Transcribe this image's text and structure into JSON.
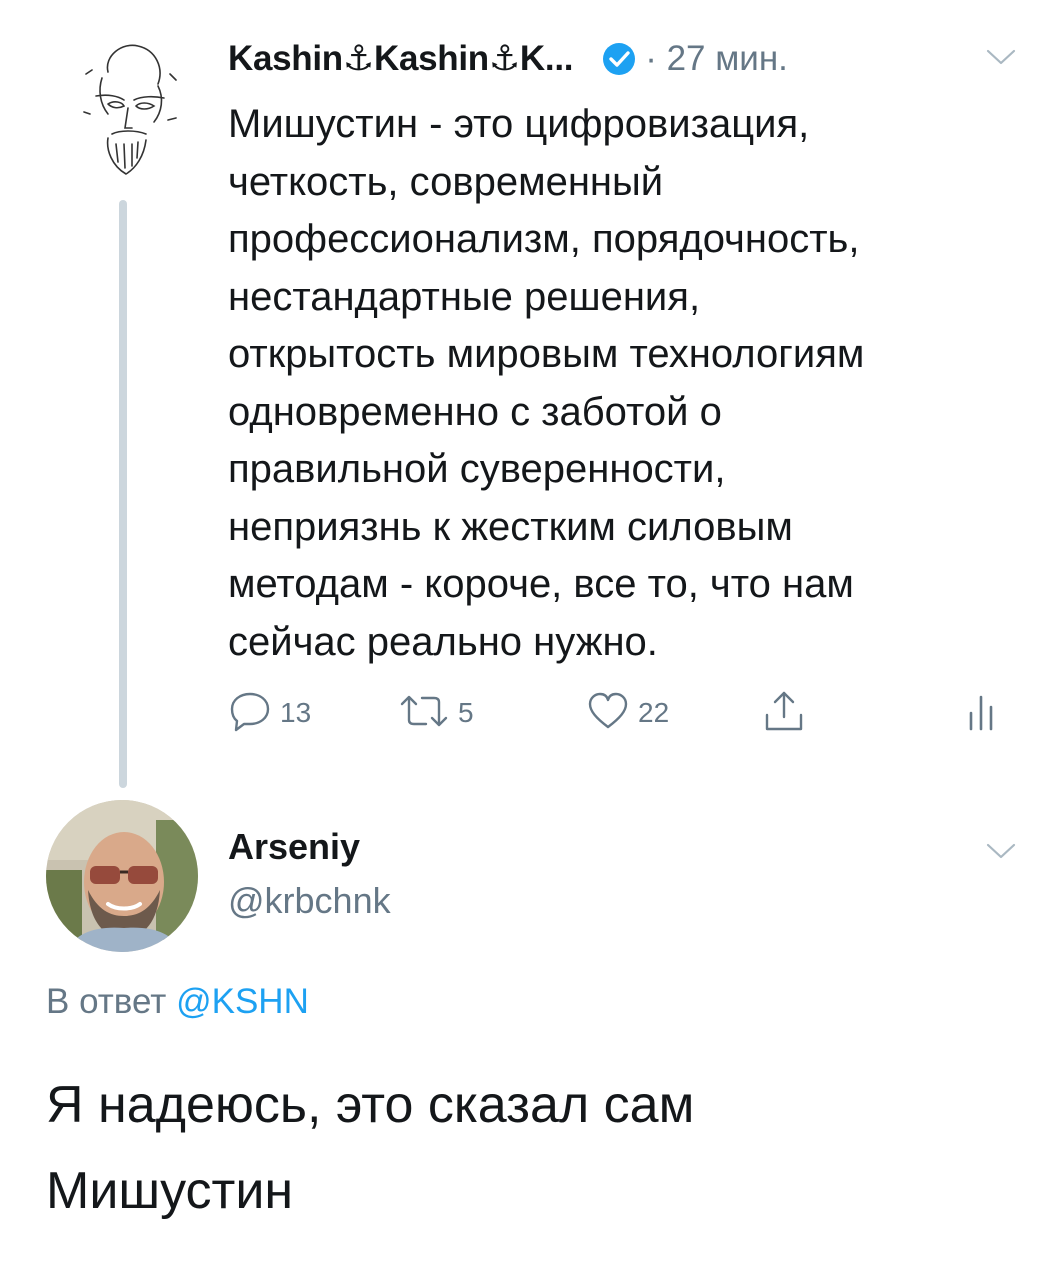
{
  "thread_tweet": {
    "display_name": "Kashin⚓Kashin⚓K...",
    "time": "· 27 мин.",
    "text": "Мишустин - это цифровизация,\nчеткость, современный\nпрофессионализм, порядочность,\nнестандартные решения,\nоткрытость мировым технологиям\nодновременно с заботой о\nправильной суверенности,\nнеприязнь к жестким силовым\nметодам - короче, все то, что нам\nсейчас реально нужно.",
    "replies": "13",
    "retweets": "5",
    "likes": "22"
  },
  "reply_tweet": {
    "display_name": "Arseniy",
    "handle": "@krbchnk",
    "reply_to_prefix": "В ответ",
    "reply_to_mention": "@KSHN",
    "text": "Я надеюсь, это сказал сам\nМишустин"
  },
  "colors": {
    "accent": "#1da1f2",
    "secondary_text": "#657786",
    "thread_line": "#ccd6dd"
  },
  "icons": [
    "reply-icon",
    "retweet-icon",
    "like-icon",
    "share-icon",
    "analytics-icon",
    "verified-badge-icon",
    "chevron-down-icon"
  ]
}
